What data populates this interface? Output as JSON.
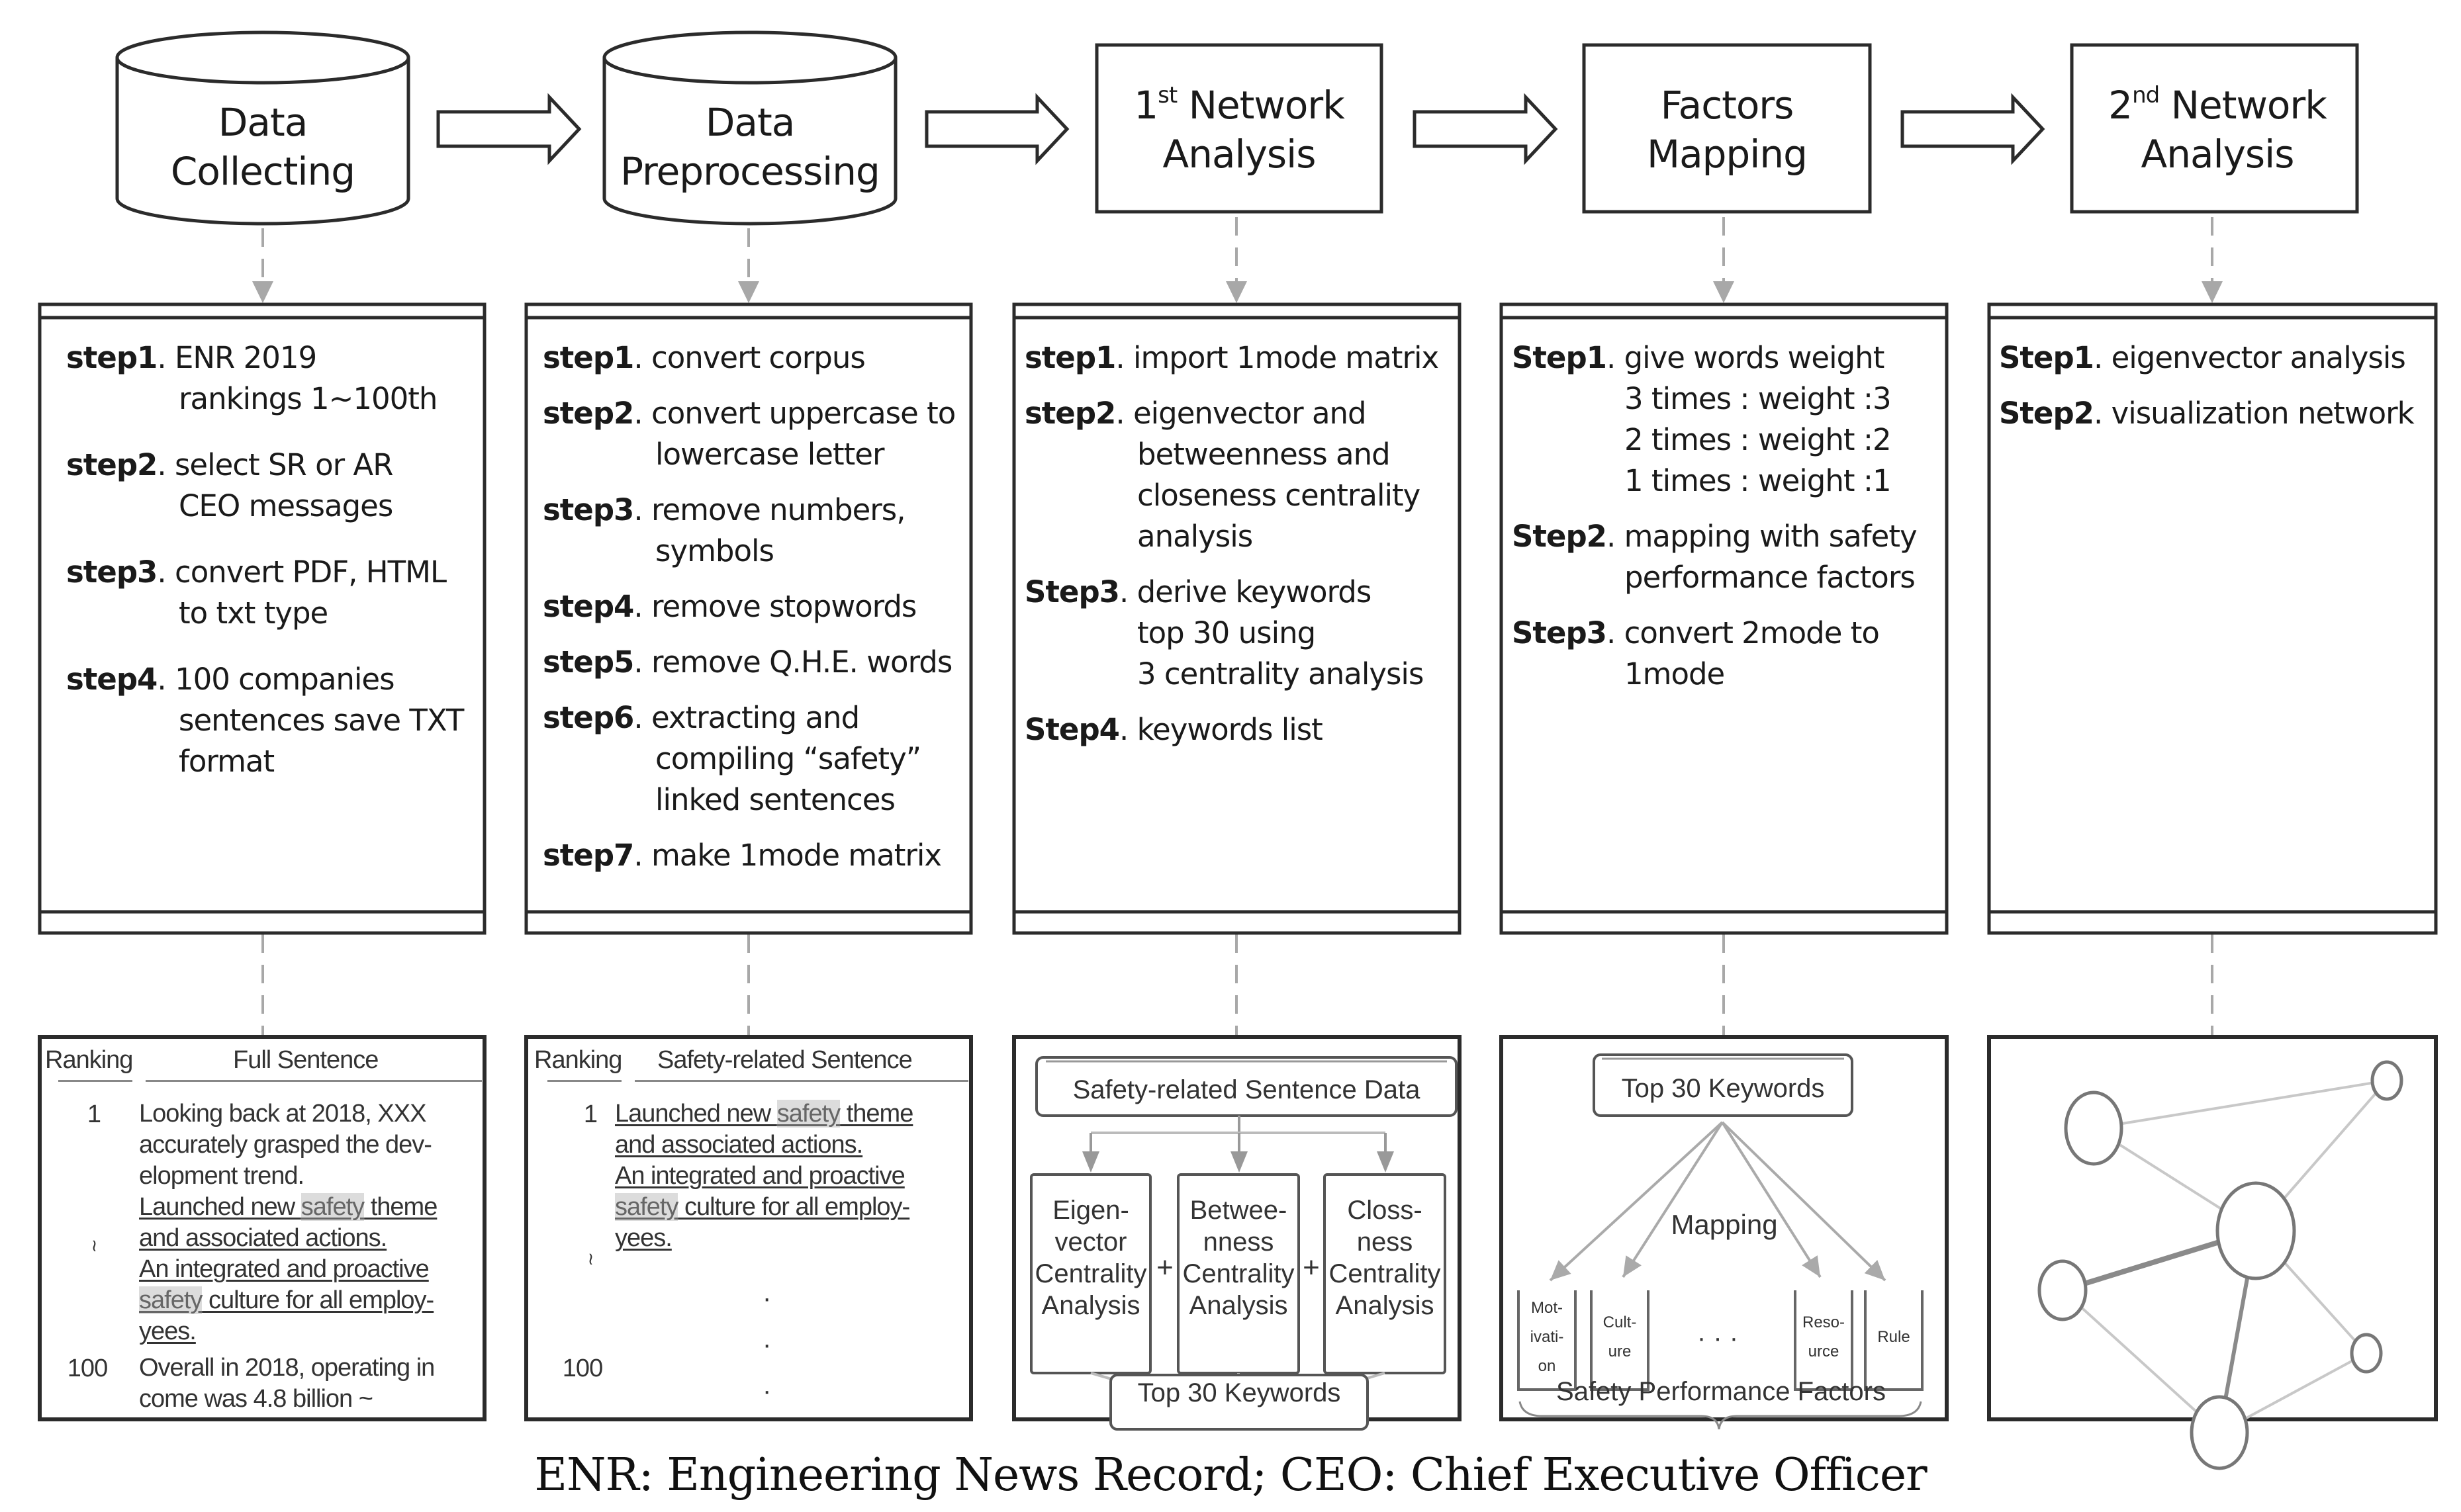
{
  "stages": [
    {
      "id": "data-collecting",
      "shape": "cylinder",
      "title_lines": [
        "Data",
        "Collecting"
      ],
      "steps": [
        {
          "label": "step1",
          "first": "ENR 2019",
          "cont": "rankings 1~100th"
        },
        {
          "label": "step2",
          "first": "select SR or AR",
          "cont": "CEO messages"
        },
        {
          "label": "step3",
          "first": "convert PDF, HTML",
          "cont": "to txt type"
        },
        {
          "label": "step4",
          "first": "100 companies",
          "cont": "sentences save TXT\nformat"
        }
      ]
    },
    {
      "id": "data-preprocessing",
      "shape": "cylinder",
      "title_lines": [
        "Data",
        "Preprocessing"
      ],
      "steps": [
        {
          "label": "step1",
          "first": "convert corpus",
          "cont": ""
        },
        {
          "label": "step2",
          "first": "convert uppercase to",
          "cont": "lowercase letter"
        },
        {
          "label": "step3",
          "first": "remove numbers,",
          "cont": "symbols"
        },
        {
          "label": "step4",
          "first": "remove stopwords",
          "cont": ""
        },
        {
          "label": "step5",
          "first": "remove Q.H.E. words",
          "cont": ""
        },
        {
          "label": "step6",
          "first": "extracting and",
          "cont": "compiling “safety”\nlinked sentences"
        },
        {
          "label": "step7",
          "first": "make 1mode matrix",
          "cont": ""
        }
      ]
    },
    {
      "id": "first-network-analysis",
      "shape": "rectangle",
      "title_prefix": "1",
      "title_sup": "st",
      "title_line1_rest": " Network",
      "title_line2": "Analysis",
      "steps": [
        {
          "label": "step1",
          "first": "import 1mode matrix",
          "cont": ""
        },
        {
          "label": "step2",
          "first": "eigenvector and",
          "cont": "betweenness and\ncloseness centrality\nanalysis"
        },
        {
          "label": "Step3",
          "first": "derive keywords",
          "cont": "top 30 using\n3 centrality analysis"
        },
        {
          "label": "Step4",
          "first": "keywords list",
          "cont": ""
        }
      ]
    },
    {
      "id": "factors-mapping",
      "shape": "rectangle",
      "title_lines": [
        "Factors",
        "Mapping"
      ],
      "steps": [
        {
          "label": "Step1",
          "first": "give words weight",
          "cont": "3 times : weight :3\n2 times : weight :2\n1 times : weight :1"
        },
        {
          "label": "Step2",
          "first": "mapping with safety",
          "cont": "performance factors"
        },
        {
          "label": "Step3",
          "first": "convert 2mode to",
          "cont": "1mode"
        }
      ]
    },
    {
      "id": "second-network-analysis",
      "shape": "rectangle",
      "title_prefix": "2",
      "title_sup": "nd",
      "title_line1_rest": " Network",
      "title_line2": "Analysis",
      "steps": [
        {
          "label": "Step1",
          "first": "eigenvector analysis",
          "cont": ""
        },
        {
          "label": "Step2",
          "first": "visualization network",
          "cont": ""
        }
      ]
    }
  ],
  "panel1": {
    "col_ranking": "Ranking",
    "col_sentence": "Full Sentence",
    "rows": [
      {
        "rank": "1",
        "segments": [
          {
            "text": "Looking back at 2018, XXX\naccurately grasped the dev-\nelopment trend.\n",
            "style": "plain"
          },
          {
            "text": "Launched new ",
            "style": "ul"
          },
          {
            "text": "safety",
            "style": "ul-hl"
          },
          {
            "text": " theme\nand associated actions.\nAn integrated and proactive\n",
            "style": "ul"
          },
          {
            "text": "safety",
            "style": "ul-hl"
          },
          {
            "text": " culture for all employ-\nyees.",
            "style": "ul"
          }
        ]
      },
      {
        "rank": "≀"
      },
      {
        "rank": "100",
        "segments": [
          {
            "text": "Overall in 2018, operating in\ncome was 4.8 billion ~",
            "style": "plain"
          }
        ]
      }
    ]
  },
  "panel2": {
    "col_ranking": "Ranking",
    "col_sentence": "Safety-related Sentence",
    "rows": [
      {
        "rank": "1",
        "segments": [
          {
            "text": "Launched new ",
            "style": "ul"
          },
          {
            "text": "safety",
            "style": "ul-hl"
          },
          {
            "text": " theme\nand associated actions.\nAn integrated and proactive\n",
            "style": "ul"
          },
          {
            "text": "safety",
            "style": "ul-hl"
          },
          {
            "text": " culture for all employ-\nyees.",
            "style": "ul"
          }
        ]
      },
      {
        "rank": "≀"
      },
      {
        "rank": "100"
      }
    ],
    "ellipsis_dots": [
      "·",
      "·",
      "·"
    ]
  },
  "panel3": {
    "source": "Safety-related Sentence Data",
    "analyses": [
      {
        "lines": [
          "Eigen-",
          "vector",
          "Centrality",
          "Analysis"
        ]
      },
      {
        "lines": [
          "Betwee-",
          "nness",
          "Centrality",
          "Analysis"
        ]
      },
      {
        "lines": [
          "Closs-",
          "ness",
          "Centrality",
          "Analysis"
        ]
      }
    ],
    "plus": "+",
    "result": "Top 30 Keywords"
  },
  "panel4": {
    "source": "Top 30 Keywords",
    "mapping_label": "Mapping",
    "factors": [
      {
        "lines": [
          "Mot-",
          "ivati-",
          "on"
        ]
      },
      {
        "lines": [
          "Cult-",
          "ure"
        ]
      },
      {
        "lines": [
          "Reso-",
          "urce"
        ]
      },
      {
        "lines": [
          "Rule"
        ]
      }
    ],
    "ellipsis": "·   ·   ·",
    "group_label": "Safety Performance Factors"
  },
  "panel5": {
    "nodes": [
      {
        "id": "n1",
        "size": "large"
      },
      {
        "id": "n2",
        "size": "small"
      },
      {
        "id": "n3",
        "size": "xlarge"
      },
      {
        "id": "n4",
        "size": "medium"
      },
      {
        "id": "n5",
        "size": "small"
      },
      {
        "id": "n6",
        "size": "large"
      }
    ],
    "edges": [
      {
        "from": "n1",
        "to": "n2",
        "weight": 1
      },
      {
        "from": "n1",
        "to": "n3",
        "weight": 1
      },
      {
        "from": "n2",
        "to": "n3",
        "weight": 1
      },
      {
        "from": "n4",
        "to": "n3",
        "weight": 3
      },
      {
        "from": "n3",
        "to": "n6",
        "weight": 2
      },
      {
        "from": "n3",
        "to": "n5",
        "weight": 1
      },
      {
        "from": "n4",
        "to": "n6",
        "weight": 1
      },
      {
        "from": "n6",
        "to": "n5",
        "weight": 1
      }
    ]
  },
  "caption": "ENR: Engineering News Record; CEO: Chief Executive Officer",
  "colors": {
    "stroke": "#2b2b2b",
    "connector": "#a8a8a8",
    "edge_light": "#c8c8c8",
    "edge_dark": "#8a8a8a",
    "highlight": "#dcdcdc"
  }
}
